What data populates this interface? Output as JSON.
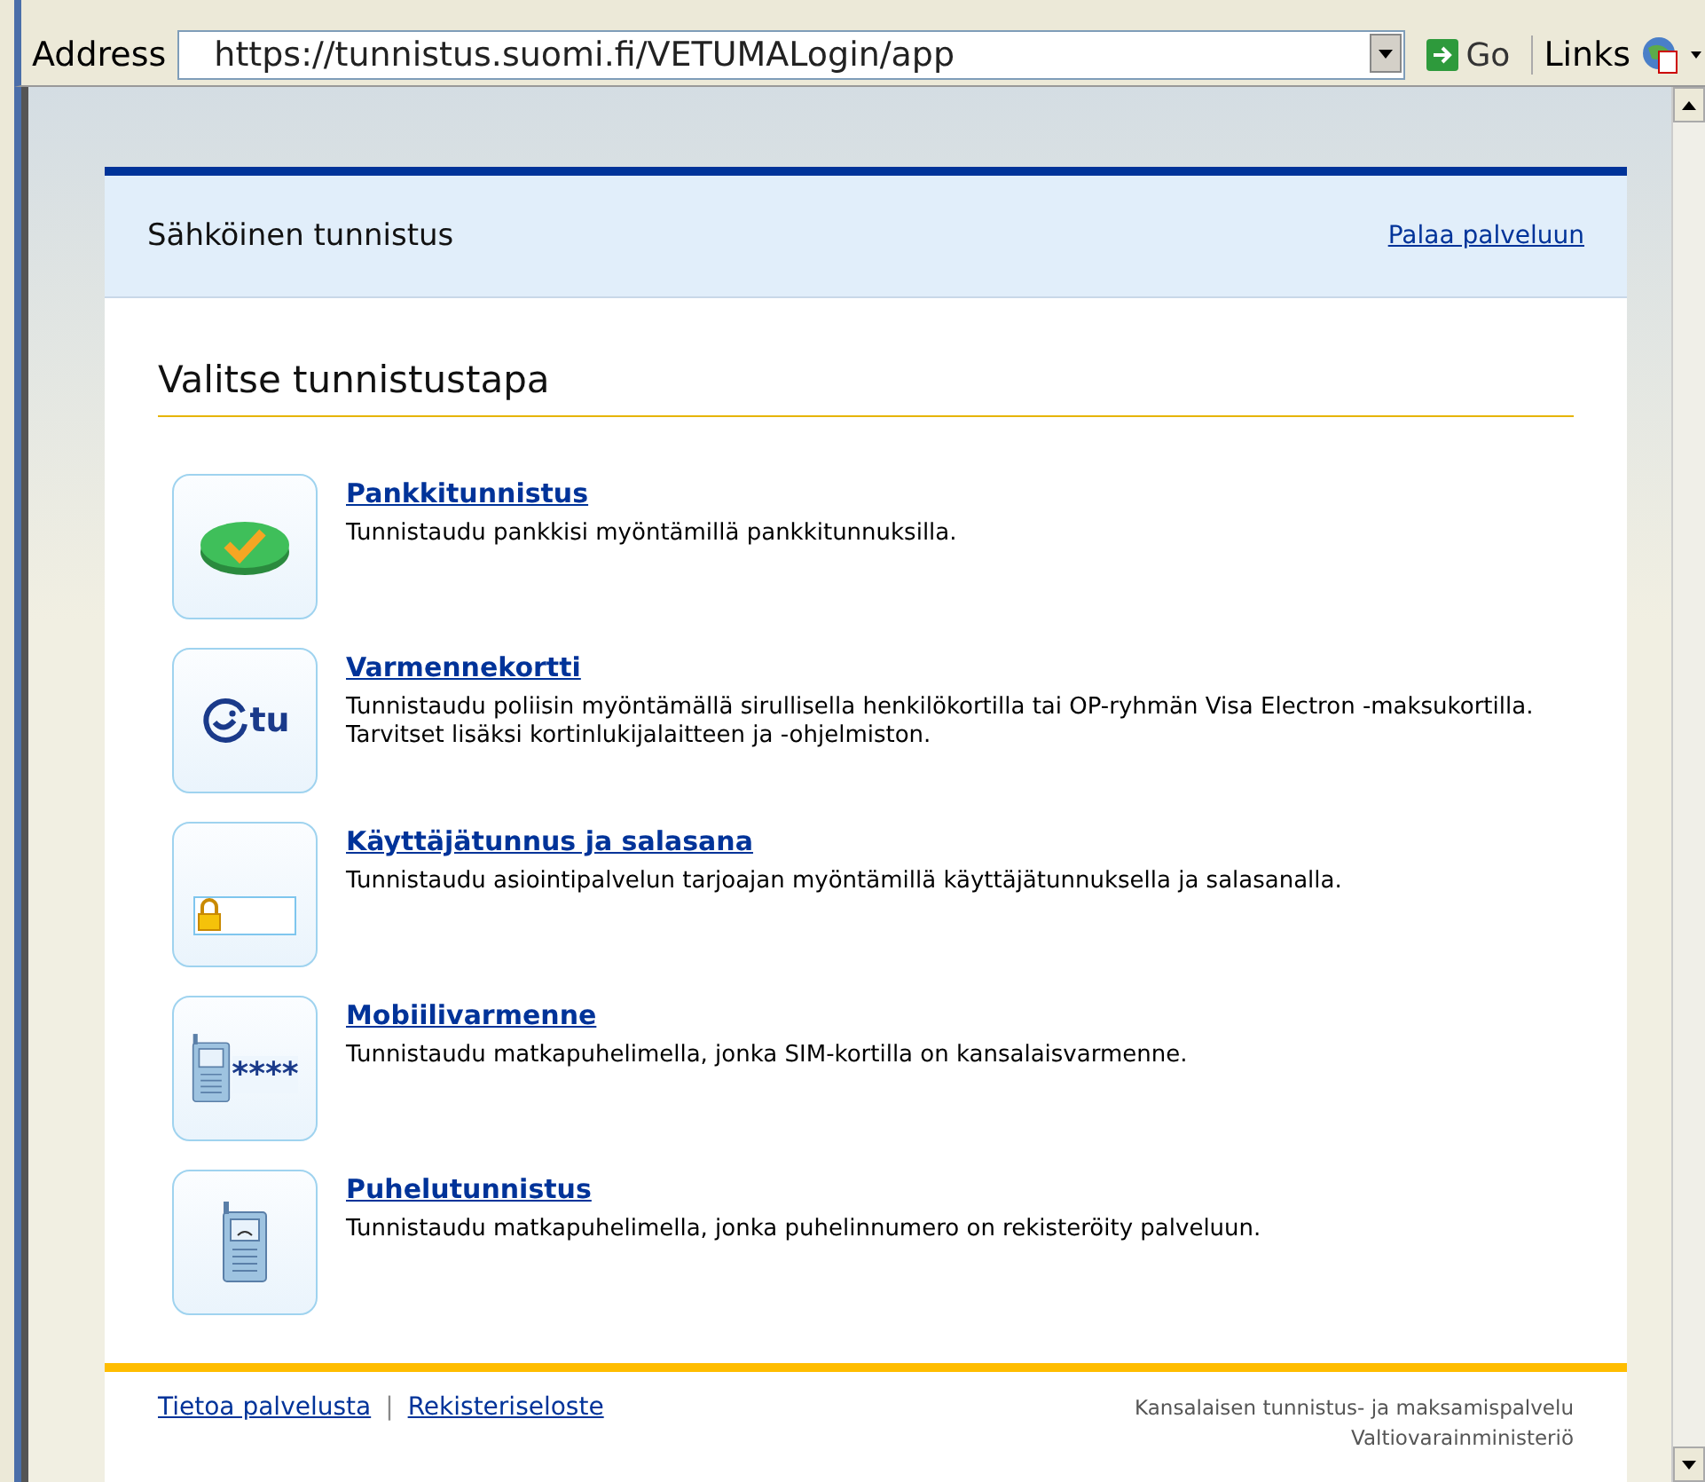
{
  "address_bar": {
    "label": "Address",
    "url": "https://tunnistus.suomi.fi/VETUMALogin/app",
    "go": "Go",
    "links": "Links"
  },
  "header": {
    "title": "Sähköinen tunnistus",
    "return_link": "Palaa palveluun"
  },
  "heading": "Valitse tunnistustapa",
  "methods": [
    {
      "kind": "bank",
      "title": "Pankkitunnistus",
      "description": "Tunnistaudu pankkisi myöntämillä pankkitunnuksilla."
    },
    {
      "kind": "card",
      "title": "Varmennekortti",
      "description": "Tunnistaudu poliisin myöntämällä sirullisella henkilökortilla tai OP-ryhmän Visa Electron -maksukortilla. Tarvitset lisäksi kortinlukijalaitteen ja -ohjelmiston.",
      "icon_text": "tu"
    },
    {
      "kind": "password",
      "title": "Käyttäjätunnus ja salasana",
      "description": "Tunnistaudu asiointipalvelun tarjoajan myöntämillä käyttäjätunnuksella ja salasanalla."
    },
    {
      "kind": "mobile",
      "title": "Mobiilivarmenne",
      "description": "Tunnistaudu matkapuhelimella, jonka SIM-kortilla on kansalaisvarmenne.",
      "icon_text": "****"
    },
    {
      "kind": "phone",
      "title": "Puhelutunnistus",
      "description": "Tunnistaudu matkapuhelimella, jonka puhelinnumero on rekisteröity palveluun."
    }
  ],
  "footer": {
    "links": [
      "Tietoa palvelusta",
      "Rekisteriseloste"
    ],
    "separator": "|",
    "info": [
      "Kansalaisen tunnistus- ja maksamispalvelu",
      "Valtiovarainministeriö"
    ]
  }
}
